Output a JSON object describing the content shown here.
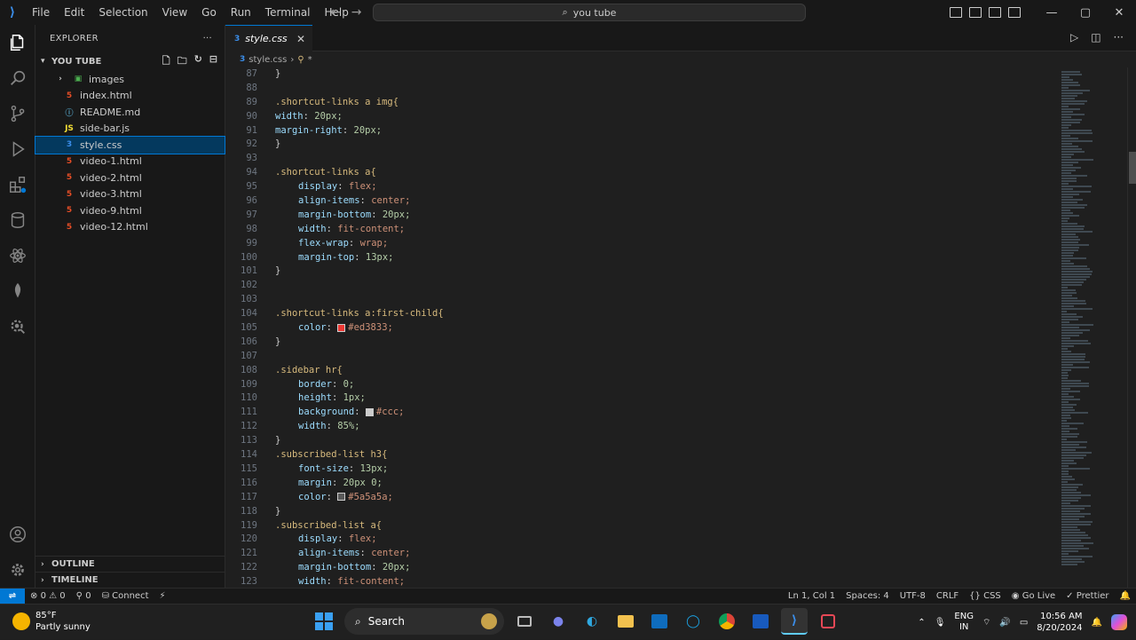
{
  "titlebar": {
    "menu": [
      "File",
      "Edit",
      "Selection",
      "View",
      "Go",
      "Run",
      "Terminal",
      "Help"
    ],
    "search": "you tube"
  },
  "explorer": {
    "title": "EXPLORER",
    "folder": "YOU TUBE",
    "items": [
      {
        "name": "images",
        "type": "folder"
      },
      {
        "name": "index.html",
        "type": "html"
      },
      {
        "name": "README.md",
        "type": "md"
      },
      {
        "name": "side-bar.js",
        "type": "js"
      },
      {
        "name": "style.css",
        "type": "css",
        "selected": true
      },
      {
        "name": "video-1.html",
        "type": "html"
      },
      {
        "name": "video-2.html",
        "type": "html"
      },
      {
        "name": "video-3.html",
        "type": "html"
      },
      {
        "name": "video-9.html",
        "type": "html"
      },
      {
        "name": "video-12.html",
        "type": "html"
      }
    ],
    "outline": "OUTLINE",
    "timeline": "TIMELINE"
  },
  "editor": {
    "tab": "style.css",
    "breadcrumb_file": "style.css",
    "breadcrumb_symbol": "*",
    "lines": [
      {
        "n": "87",
        "t": "}",
        "k": "pun",
        "i": 0
      },
      {
        "n": "88",
        "t": "",
        "k": "pun",
        "i": 0
      },
      {
        "n": "89",
        "t": ".shortcut-links a img{",
        "k": "sel",
        "i": 0
      },
      {
        "n": "90",
        "p": "width",
        "v": "20px;",
        "i": 0
      },
      {
        "n": "91",
        "p": "margin-right",
        "v": "20px;",
        "i": 0
      },
      {
        "n": "92",
        "t": "}",
        "k": "pun",
        "i": 0
      },
      {
        "n": "93",
        "t": "",
        "k": "pun",
        "i": 0
      },
      {
        "n": "94",
        "t": ".shortcut-links a{",
        "k": "sel",
        "i": 0
      },
      {
        "n": "95",
        "p": "display",
        "v": "flex;",
        "i": 1
      },
      {
        "n": "96",
        "p": "align-items",
        "v": "center;",
        "i": 1
      },
      {
        "n": "97",
        "p": "margin-bottom",
        "v": "20px;",
        "i": 1
      },
      {
        "n": "98",
        "p": "width",
        "v": "fit-content;",
        "i": 1
      },
      {
        "n": "99",
        "p": "flex-wrap",
        "v": "wrap;",
        "i": 1
      },
      {
        "n": "100",
        "p": "margin-top",
        "v": "13px;",
        "i": 1
      },
      {
        "n": "101",
        "t": "}",
        "k": "pun",
        "i": 0
      },
      {
        "n": "102",
        "t": "",
        "k": "pun",
        "i": 0
      },
      {
        "n": "103",
        "t": "",
        "k": "pun",
        "i": 0
      },
      {
        "n": "104",
        "t": ".shortcut-links a:first-child{",
        "k": "sel",
        "i": 0
      },
      {
        "n": "105",
        "p": "color",
        "v": "#ed3833;",
        "sw": "#ed3833",
        "i": 1
      },
      {
        "n": "106",
        "t": "}",
        "k": "pun",
        "i": 0
      },
      {
        "n": "107",
        "t": "",
        "k": "pun",
        "i": 0
      },
      {
        "n": "108",
        "t": ".sidebar hr{",
        "k": "sel",
        "i": 0
      },
      {
        "n": "109",
        "p": "border",
        "v": "0;",
        "i": 1
      },
      {
        "n": "110",
        "p": "height",
        "v": "1px;",
        "i": 1
      },
      {
        "n": "111",
        "p": "background",
        "v": "#ccc;",
        "sw": "#cccccc",
        "i": 1
      },
      {
        "n": "112",
        "p": "width",
        "v": "85%;",
        "i": 1
      },
      {
        "n": "113",
        "t": "}",
        "k": "pun",
        "i": 0
      },
      {
        "n": "114",
        "t": ".subscribed-list h3{",
        "k": "sel",
        "i": 0
      },
      {
        "n": "115",
        "p": "font-size",
        "v": "13px;",
        "i": 1
      },
      {
        "n": "116",
        "p": "margin",
        "v": "20px 0;",
        "i": 1
      },
      {
        "n": "117",
        "p": "color",
        "v": "#5a5a5a;",
        "sw": "#5a5a5a",
        "i": 1
      },
      {
        "n": "118",
        "t": "}",
        "k": "pun",
        "i": 0
      },
      {
        "n": "119",
        "t": ".subscribed-list a{",
        "k": "sel",
        "i": 0
      },
      {
        "n": "120",
        "p": "display",
        "v": "flex;",
        "i": 1
      },
      {
        "n": "121",
        "p": "align-items",
        "v": "center;",
        "i": 1
      },
      {
        "n": "122",
        "p": "margin-bottom",
        "v": "20px;",
        "i": 1
      },
      {
        "n": "123",
        "p": "width",
        "v": "fit-content;",
        "i": 1
      }
    ]
  },
  "statusbar": {
    "errors": "0",
    "warnings": "0",
    "ports": "0",
    "connect": "Connect",
    "position": "Ln 1, Col 1",
    "spaces": "Spaces: 4",
    "encoding": "UTF-8",
    "eol": "CRLF",
    "language": "CSS",
    "golive": "Go Live",
    "prettier": "Prettier"
  },
  "taskbar": {
    "temp": "85°F",
    "weather": "Partly sunny",
    "search": "Search",
    "lang1": "ENG",
    "lang2": "IN",
    "time": "10:56 AM",
    "date": "8/20/2024"
  },
  "colors": {
    "accent": "#0078d4",
    "selector": "#d7ba7d",
    "property": "#9cdcfe",
    "value": "#ce9178"
  }
}
